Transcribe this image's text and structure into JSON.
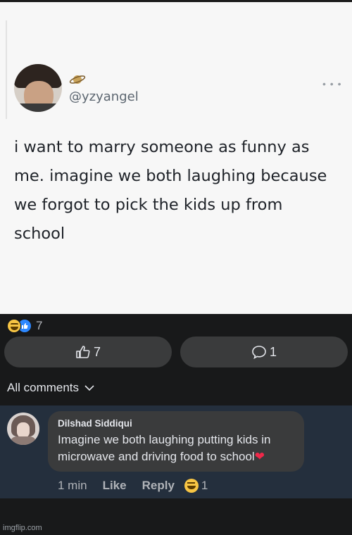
{
  "tweet": {
    "handle": "@yzyangel",
    "text": "i want to marry someone as funny as me. imagine we both laughing because we forgot to pick the kids up from school",
    "icons": [
      "avatar",
      "planet-icon",
      "more-icon"
    ]
  },
  "post": {
    "reaction_count": "7",
    "reaction_icons": [
      "haha-emoji",
      "like-emoji"
    ],
    "like_button_count": "7",
    "comment_button_count": "1",
    "all_comments_label": "All comments"
  },
  "comment": {
    "author": "Dilshad Siddiqui",
    "text": "Imagine we both laughing putting kids in microwave and driving food to school",
    "time": "1 min",
    "like_label": "Like",
    "reply_label": "Reply",
    "reaction_count": "1"
  },
  "watermark": "imgflip.com",
  "colors": {
    "background": "#18191a",
    "button_bg": "#3a3b3c",
    "comment_section_bg": "#242f3d",
    "like_blue": "#2d88ff",
    "heart_red": "#f02849"
  }
}
